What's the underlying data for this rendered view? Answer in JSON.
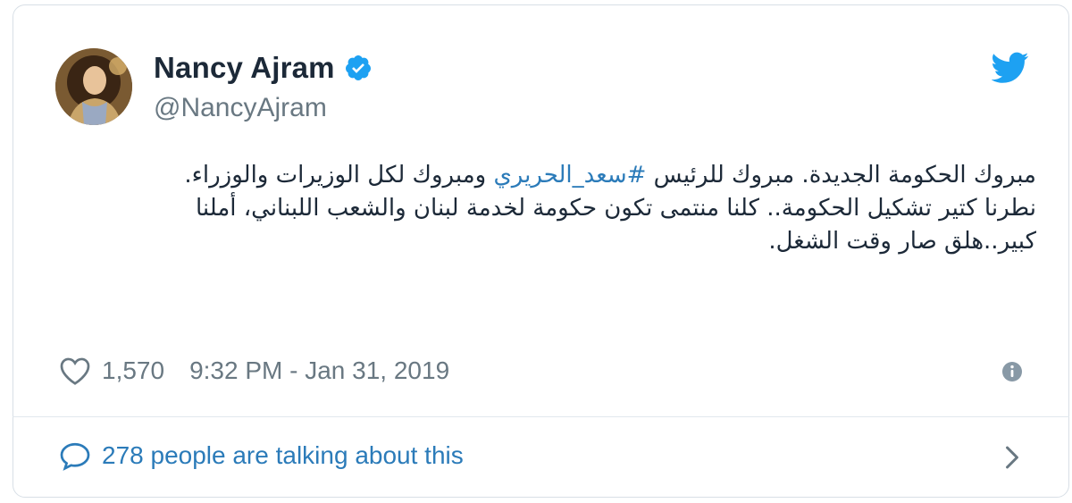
{
  "tweet": {
    "author": {
      "display_name": "Nancy Ajram",
      "handle": "@NancyAjram",
      "verified": true
    },
    "text": {
      "part1": "مبروك الحكومة الجديدة. مبروك للرئيس ",
      "hashtag": "#سعد_الحريري",
      "part2": " ومبروك لكل الوزيرات والوزراء.",
      "line2": "نطرنا كتير تشكيل الحكومة.. كلنا منتمى تكون حكومة لخدمة لبنان والشعب اللبناني، أملنا كبير..هلق صار وقت الشغل."
    },
    "likes": "1,570",
    "timestamp": "9:32 PM - Jan 31, 2019",
    "talking": "278 people are talking about this"
  },
  "colors": {
    "link": "#2b7bb9",
    "muted": "#697882",
    "twitter_blue": "#1da1f2",
    "verified_blue": "#1da1f2"
  },
  "icons": {
    "brand": "twitter-bird-icon",
    "verified": "verified-badge-icon",
    "like": "heart-icon",
    "info": "info-icon",
    "reply": "speech-bubble-icon",
    "more": "chevron-right-icon"
  }
}
